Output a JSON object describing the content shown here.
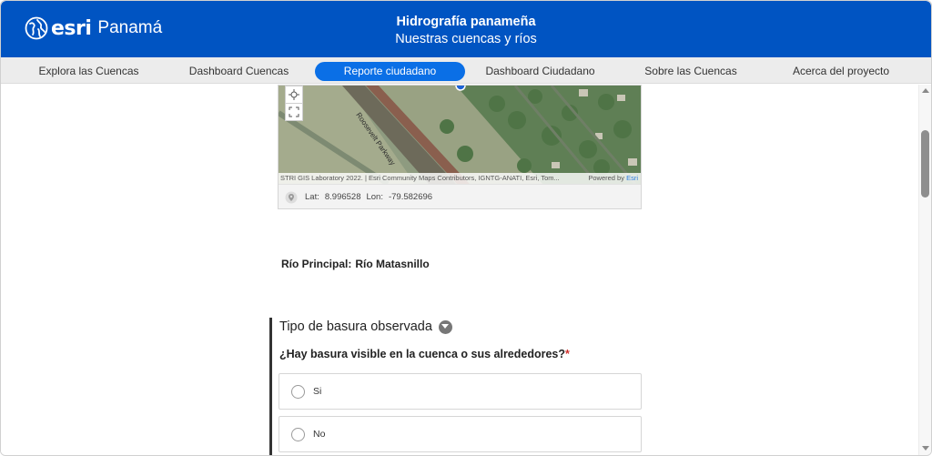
{
  "header": {
    "brand": "esri",
    "country": "Panamá",
    "title": "Hidrografía panameña",
    "subtitle": "Nuestras cuencas y ríos",
    "background_color": "#0054c2"
  },
  "nav": {
    "active_color": "#0a6fe6",
    "items": [
      {
        "label": "Explora las Cuencas",
        "active": false
      },
      {
        "label": "Dashboard Cuencas",
        "active": false
      },
      {
        "label": "Reporte ciudadano",
        "active": true
      },
      {
        "label": "Dashboard Ciudadano",
        "active": false
      },
      {
        "label": "Sobre las Cuencas",
        "active": false
      },
      {
        "label": "Acerca del proyecto",
        "active": false
      }
    ]
  },
  "map": {
    "attribution": "STRI GIS Laboratory 2022. | Esri Community Maps Contributors, IGNTG-ANATI, Esri, Tom...",
    "powered_by": "Powered by",
    "powered_link": "Esri",
    "road_label": "Roosevelt Parkway",
    "coords": {
      "lat_label": "Lat:",
      "lat": "8.996528",
      "lon_label": "Lon:",
      "lon": "-79.582696"
    },
    "controls": [
      "locate-icon",
      "fullscreen-icon"
    ]
  },
  "form": {
    "rio_label": "Río Principal:",
    "rio_value": "Río Matasnillo",
    "section_title": "Tipo de basura observada",
    "question": "¿Hay basura visible en la cuenca o sus alrededores?",
    "required_marker": "*",
    "options": [
      {
        "label": "Si",
        "selected": false
      },
      {
        "label": "No",
        "selected": false
      }
    ]
  }
}
